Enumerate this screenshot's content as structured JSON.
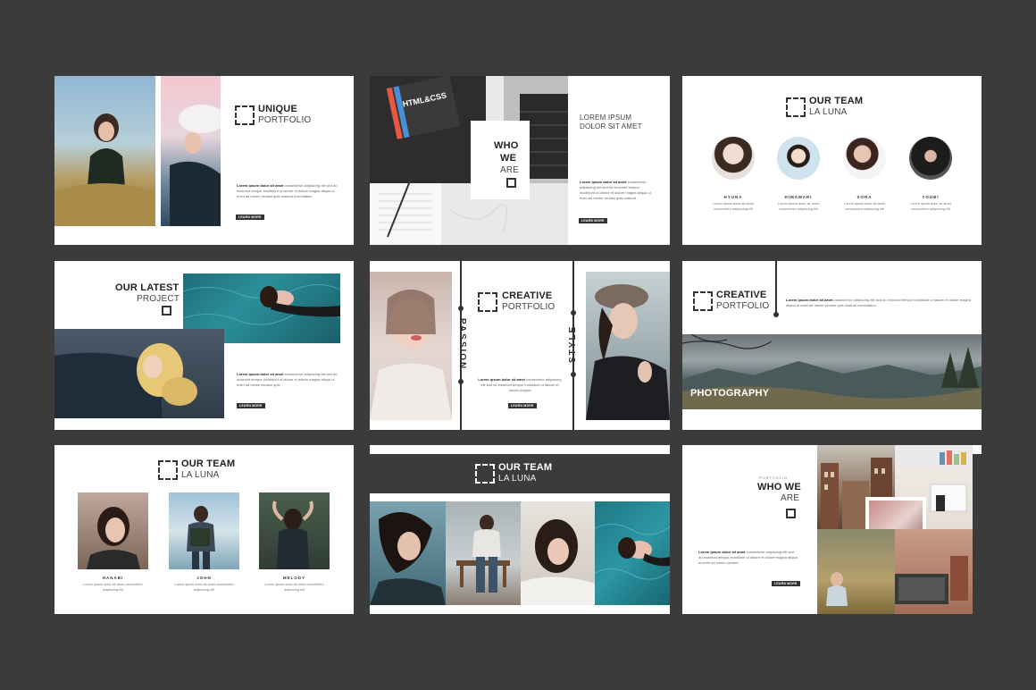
{
  "slides": {
    "s1": {
      "title_bold": "UNIQUE",
      "title_light": "PORTFOLIO",
      "para_bold": "Lorem ipsum dolor sit amet",
      "para": "consectetur adipiscing elit sed do eiusmod tempor incididunt ut labore et dolore magna aliqua ut enim ad minim veniam quis nostrud exercitation",
      "button": "LEARN MORE"
    },
    "s2": {
      "who_1": "WHO",
      "who_2": "WE",
      "who_3": "ARE",
      "lorem_1": "LOREM IPSUM",
      "lorem_2": "DOLOR SIT AMET",
      "book_text": "HTML&CSS",
      "para_bold": "Lorem ipsum dolor sit amet",
      "para": "consectetur adipiscing elit sed do eiusmod tempor incididunt ut labore et dolore magna aliqua ut enim ad minim veniam quis nostrud",
      "button": "LEARN MORE"
    },
    "s3": {
      "title_bold": "OUR TEAM",
      "title_light": "LA LUNA",
      "members": [
        {
          "name": "HYUNA",
          "desc": "Lorem ipsum dolor sit amet consectetur adipiscing elit"
        },
        {
          "name": "HIMAWARI",
          "desc": "Lorem ipsum dolor sit amet consectetur adipiscing elit"
        },
        {
          "name": "SORA",
          "desc": "Lorem ipsum dolor sit amet consectetur adipiscing elit"
        },
        {
          "name": "YOUBI",
          "desc": "Lorem ipsum dolor sit amet consectetur adipiscing elit"
        }
      ]
    },
    "s4": {
      "title_bold": "OUR LATEST",
      "title_light": "PROJECT",
      "para_bold": "Lorem ipsum dolor sit amet",
      "para": "consectetur adipiscing elit sed do eiusmod tempor incididunt ut labore et dolore magna aliqua ut enim ad minim veniam quis",
      "button": "LEARN MORE"
    },
    "s5": {
      "title_bold": "CREATIVE",
      "title_light": "PORTFOLIO",
      "passion": "PASSION",
      "style": "STYLE",
      "para_bold": "Lorem ipsum dolor sit amet",
      "para": "consectetur adipiscing elit sed do eiusmod tempor incididunt ut labore et dolore magna",
      "button": "LEARN MORE"
    },
    "s6": {
      "title_bold": "CREATIVE",
      "title_light": "PORTFOLIO",
      "para_bold": "Lorem ipsum dolor sit amet",
      "para": "consectetur adipiscing elit sed do eiusmod tempor incididunt ut labore et dolore magna aliqua ut enim ad minim veniam quis nostrud exercitation",
      "photo_label": "PHOTOGRAPHY"
    },
    "s7": {
      "title_bold": "OUR TEAM",
      "title_light": "LA LUNA",
      "members": [
        {
          "name": "HANABI",
          "desc": "Lorem ipsum dolor sit amet consectetur adipiscing elit"
        },
        {
          "name": "JOHN",
          "desc": "Lorem ipsum dolor sit amet consectetur adipiscing elit"
        },
        {
          "name": "MELODY",
          "desc": "Lorem ipsum dolor sit amet consectetur adipiscing elit"
        }
      ]
    },
    "s8": {
      "title_bold": "OUR TEAM",
      "title_light": "LA LUNA"
    },
    "s9": {
      "kicker": "PORTFOLIO",
      "title_bold": "WHO WE",
      "title_light": "ARE",
      "para_bold": "Lorem ipsum dolor sit amet",
      "para": "consectetur adipiscing elit sed do eiusmod tempor incididunt ut labore et dolore magna aliqua ut enim ad minim veniam",
      "button": "LEARN MORE"
    }
  },
  "colors": {
    "background": "#3b3b3b",
    "accent": "#333333",
    "slide": "#ffffff"
  }
}
